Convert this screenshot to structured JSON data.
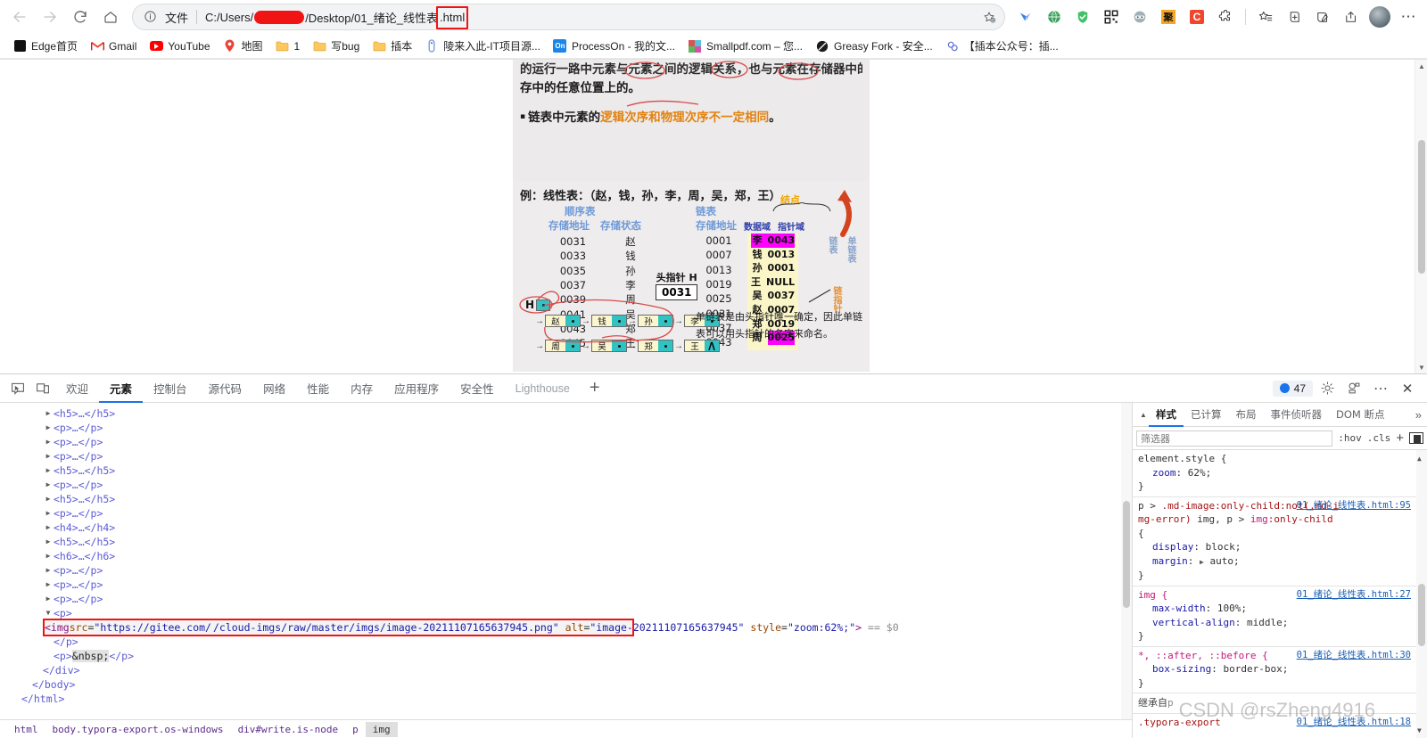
{
  "browser": {
    "nav": {
      "back": "back-arrow",
      "forward": "forward-arrow",
      "reload": "reload",
      "home": "home"
    },
    "omnibox": {
      "info_icon": "info-circle-icon",
      "scheme_label": "文件",
      "url_prefix": "C:/Users/",
      "url_redacted": "",
      "url_middle": "/Desktop/01_绪论_线性表",
      "url_highlight": ".html",
      "favorite_icon": "star-icon"
    },
    "extensions": [
      {
        "name": "extension-split-screen",
        "glyph": "⎘"
      },
      {
        "name": "extension-blue-bird",
        "glyph": "◤"
      },
      {
        "name": "extension-globe",
        "glyph": "🌍"
      },
      {
        "name": "extension-shield-green",
        "glyph": "✓"
      },
      {
        "name": "extension-qrcode",
        "glyph": "▦"
      },
      {
        "name": "extension-ninja",
        "glyph": "◔"
      },
      {
        "name": "extension-ju-orange",
        "glyph": "聚"
      },
      {
        "name": "extension-c-red",
        "glyph": "C"
      },
      {
        "name": "extension-puzzle",
        "glyph": "❖"
      }
    ],
    "actions": [
      {
        "name": "collections-icon",
        "glyph": "☆"
      },
      {
        "name": "add-tab-icon",
        "glyph": "⊞"
      },
      {
        "name": "screenshot-icon",
        "glyph": "◌"
      },
      {
        "name": "share-icon",
        "glyph": "↗"
      }
    ],
    "avatar": "profile-avatar",
    "settings_more": "⋯",
    "bookmarks": [
      {
        "label": "Edge首页",
        "icon": "edge-home"
      },
      {
        "label": "Gmail",
        "icon": "gmail"
      },
      {
        "label": "YouTube",
        "icon": "youtube"
      },
      {
        "label": "地图",
        "icon": "maps-pin"
      },
      {
        "label": "1",
        "icon": "folder"
      },
      {
        "label": "写bug",
        "icon": "folder"
      },
      {
        "label": "插本",
        "icon": "folder"
      },
      {
        "label": "陵来入此-IT项目源...",
        "icon": "site"
      },
      {
        "label": "ProcessOn - 我的文...",
        "icon": "processon"
      },
      {
        "label": "Smallpdf.com – 您...",
        "icon": "smallpdf"
      },
      {
        "label": "Greasy Fork - 安全...",
        "icon": "greasyfork"
      },
      {
        "label": "【插本公众号：插...",
        "icon": "wechat"
      }
    ]
  },
  "document": {
    "slide_top": {
      "line_cut": "的运行一路中元素与元素之间的逻辑关系，也与元素在存储器中的相对位置无关，它可以是存放在内",
      "line2": "存中的任意位置上的。",
      "bullet": "链表中元素的",
      "bullet_orange": "逻辑次序和物理次序不一定相同",
      "bullet_tail": "。"
    },
    "slide_bottom": {
      "example_title": "例：线性表：（赵，钱，孙，李，周，吴，郑，王）",
      "seq_title": "顺序表",
      "seq_col1": "存储地址",
      "seq_col2": "存储状态",
      "seq_rows": [
        {
          "addr": "0031",
          "val": "赵"
        },
        {
          "addr": "0033",
          "val": "钱"
        },
        {
          "addr": "0035",
          "val": "孙"
        },
        {
          "addr": "0037",
          "val": "李"
        },
        {
          "addr": "0039",
          "val": "周"
        },
        {
          "addr": "0041",
          "val": "吴"
        },
        {
          "addr": "0043",
          "val": "郑"
        },
        {
          "addr": "0045",
          "val": "王"
        }
      ],
      "head_ptr_label": "头指针 H",
      "head_ptr_value": "0031",
      "link_title": "链表",
      "link_col1": "存储地址",
      "link_col2": "数据域",
      "link_col3": "指针域",
      "node_label": "结点",
      "link_rows": [
        {
          "addr": "0001",
          "data": "李",
          "ptr": "0043",
          "hl": true
        },
        {
          "addr": "0007",
          "data": "钱",
          "ptr": "0013",
          "hl": false
        },
        {
          "addr": "0013",
          "data": "孙",
          "ptr": "0001",
          "hl": false
        },
        {
          "addr": "0019",
          "data": "王",
          "ptr": "NULL",
          "hl": false
        },
        {
          "addr": "0025",
          "data": "吴",
          "ptr": "0037",
          "hl": false
        },
        {
          "addr": "0031",
          "data": "赵",
          "ptr": "0007",
          "hl": false
        },
        {
          "addr": "0037",
          "data": "郑",
          "ptr": "0019",
          "hl": false
        },
        {
          "addr": "0043",
          "data": "周",
          "ptr": "0025",
          "hl": true
        }
      ],
      "side_label_1": "链表",
      "side_label_2": "单链表",
      "side_label_3": "链指针",
      "chain_head": "H",
      "chain_row1": [
        "赵",
        "钱",
        "孙",
        "李"
      ],
      "chain_row2": [
        "周",
        "吴",
        "郑",
        "王"
      ],
      "note_line1": "单链表是由头指针唯一确定，因此单链",
      "note_line2": "表可以用头指针的名字来命名。"
    }
  },
  "devtools": {
    "left_icons": [
      {
        "name": "inspect-element-icon"
      },
      {
        "name": "device-toolbar-icon"
      }
    ],
    "tabs": [
      {
        "label": "欢迎",
        "active": false,
        "muted": false
      },
      {
        "label": "元素",
        "active": true,
        "muted": false
      },
      {
        "label": "控制台",
        "active": false,
        "muted": false
      },
      {
        "label": "源代码",
        "active": false,
        "muted": false
      },
      {
        "label": "网络",
        "active": false,
        "muted": false
      },
      {
        "label": "性能",
        "active": false,
        "muted": false
      },
      {
        "label": "内存",
        "active": false,
        "muted": false
      },
      {
        "label": "应用程序",
        "active": false,
        "muted": false
      },
      {
        "label": "安全性",
        "active": false,
        "muted": false
      },
      {
        "label": "Lighthouse",
        "active": false,
        "muted": true
      }
    ],
    "add_tab": "+",
    "issues_count": "47",
    "settings_icon": "gear-icon",
    "customize_icon": "devices-icon",
    "more_icon": "⋯",
    "close_icon": "✕",
    "dom_lines": [
      {
        "indent": 3,
        "tri": "▶",
        "html": "<h5>…</h5>"
      },
      {
        "indent": 3,
        "tri": "▶",
        "html": "<p>…</p>"
      },
      {
        "indent": 3,
        "tri": "▶",
        "html": "<p>…</p>"
      },
      {
        "indent": 3,
        "tri": "▶",
        "html": "<p>…</p>"
      },
      {
        "indent": 3,
        "tri": "▶",
        "html": "<h5>…</h5>"
      },
      {
        "indent": 3,
        "tri": "▶",
        "html": "<p>…</p>"
      },
      {
        "indent": 3,
        "tri": "▶",
        "html": "<h5>…</h5>"
      },
      {
        "indent": 3,
        "tri": "▶",
        "html": "<p>…</p>"
      },
      {
        "indent": 3,
        "tri": "▶",
        "html": "<h4>…</h4>"
      },
      {
        "indent": 3,
        "tri": "▶",
        "html": "<h5>…</h5>"
      },
      {
        "indent": 3,
        "tri": "▶",
        "html": "<h6>…</h6>"
      },
      {
        "indent": 3,
        "tri": "▶",
        "html": "<p>…</p>"
      },
      {
        "indent": 3,
        "tri": "▶",
        "html": "<p>…</p>"
      },
      {
        "indent": 3,
        "tri": "▶",
        "html": "<p>…</p>"
      },
      {
        "indent": 3,
        "tri": "▼",
        "html": "<p>"
      }
    ],
    "selected_line": {
      "img_open": "<img ",
      "attr_src": "src",
      "src_prefix": "\"https://gitee.com/",
      "src_suffix": "/cloud-imgs/raw/master/imgs/image-20211107165637945.png\"",
      "attr_alt": "alt",
      "alt_val": "\"image-20211107165637945\"",
      "attr_style": "style",
      "style_val": "\"zoom:62%;\"",
      "close": ">",
      "dollar": "== $0"
    },
    "dom_lines_after": [
      {
        "indent": 3,
        "tri": "",
        "html": "</p>"
      },
      {
        "indent": 3,
        "tri": "",
        "html": "<p>&nbsp;</p>"
      },
      {
        "indent": 2,
        "tri": "",
        "html": "</div>"
      },
      {
        "indent": 1,
        "tri": "",
        "html": "</body>"
      },
      {
        "indent": 0,
        "tri": "",
        "html": "</html>"
      }
    ],
    "breadcrumb": [
      {
        "text": "html",
        "sel": false
      },
      {
        "text": "body.typora-export.os-windows",
        "sel": false
      },
      {
        "text": "div#write.is-node",
        "sel": false
      },
      {
        "text": "p",
        "sel": false
      },
      {
        "text": "img",
        "sel": true
      }
    ],
    "styles": {
      "tabs": [
        {
          "label": "样式",
          "active": true
        },
        {
          "label": "已计算",
          "active": false
        },
        {
          "label": "布局",
          "active": false
        },
        {
          "label": "事件侦听器",
          "active": false
        },
        {
          "label": "DOM 断点",
          "active": false
        }
      ],
      "more": "»",
      "filter_placeholder": "筛选器",
      "hov": ":hov",
      "cls": ".cls",
      "rules": [
        {
          "selector": "element.style {",
          "link": "",
          "decls": [
            {
              "prop": "zoom",
              "value": "62%;"
            }
          ],
          "close": "}"
        },
        {
          "selector": "p > .md-image:only-child:not(.md-img-error) img, p > img:only-child {",
          "link": "01_绪论_线性表.html:95",
          "decls": [
            {
              "prop": "display",
              "value": "block;"
            },
            {
              "prop": "margin",
              "value": "auto;",
              "expandable": true
            }
          ],
          "close": "}"
        },
        {
          "selector": "img {",
          "link": "01_绪论_线性表.html:27",
          "decls": [
            {
              "prop": "max-width",
              "value": "100%;"
            },
            {
              "prop": "vertical-align",
              "value": "middle;"
            }
          ],
          "close": "}"
        },
        {
          "selector": "*, ::after, ::before {",
          "link": "01_绪论_线性表.html:30",
          "decls": [
            {
              "prop": "box-sizing",
              "value": "border-box;"
            }
          ],
          "close": "}"
        }
      ],
      "inherited_label": "继承自",
      "inherited_from": "p",
      "last_rule_selector": ".typora-export",
      "last_rule_link": "01_绪论_线性表.html:18"
    }
  },
  "watermark": "CSDN @rsZheng4916"
}
